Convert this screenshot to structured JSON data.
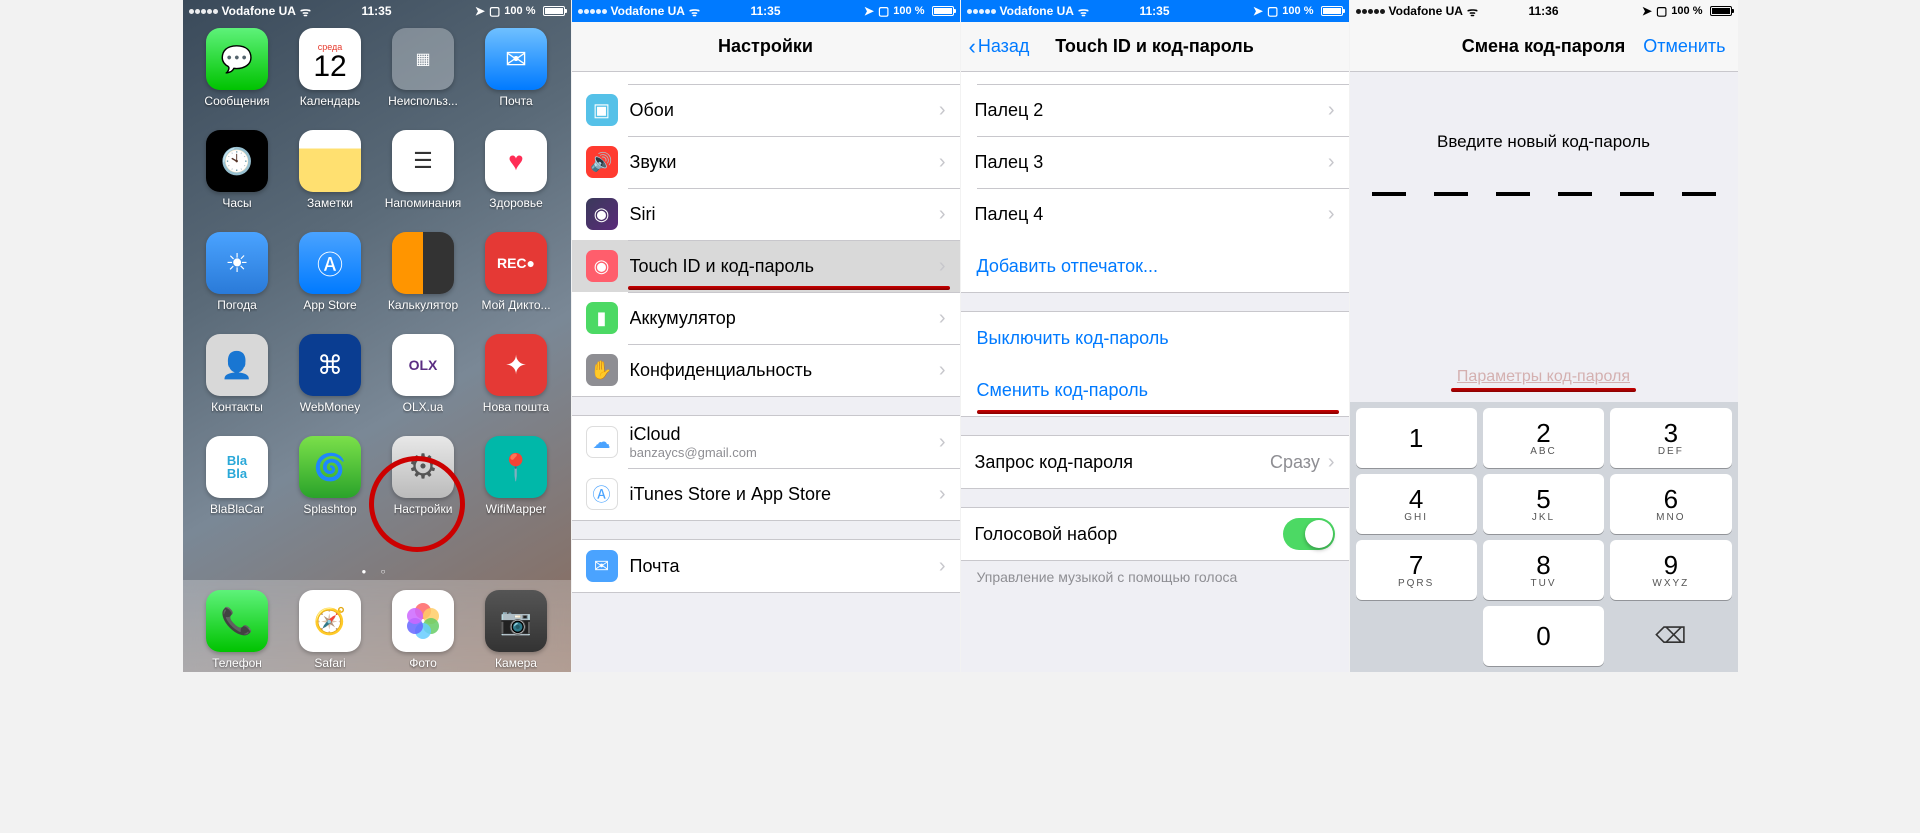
{
  "status": {
    "carrier": "Vodafone UA",
    "time1": "11:35",
    "time2": "11:36",
    "battery": "100 %"
  },
  "panel1": {
    "calendar_dow": "среда",
    "calendar_day": "12",
    "apps": {
      "messages": "Сообщения",
      "calendar": "Календарь",
      "folder": "Неиспольз...",
      "mail": "Почта",
      "clock": "Часы",
      "notes": "Заметки",
      "reminders": "Напоминания",
      "health": "Здоровье",
      "weather": "Погода",
      "appstore": "App Store",
      "calc": "Калькулятор",
      "rec": "Мой Дикто...",
      "contacts": "Контакты",
      "webmoney": "WebMoney",
      "olx": "OLX.ua",
      "nova": "Нова пошта",
      "blabla": "BlaBlaCar",
      "splashtop": "Splashtop",
      "settings": "Настройки",
      "wifimapper": "WifiMapper"
    },
    "dock": {
      "phone": "Телефон",
      "safari": "Safari",
      "photos": "Фото",
      "camera": "Камера"
    },
    "rec_text": "REC●"
  },
  "panel2": {
    "title": "Настройки",
    "rows": {
      "wallpaper": "Обои",
      "sounds": "Звуки",
      "siri": "Siri",
      "touchid": "Touch ID и код-пароль",
      "battery": "Аккумулятор",
      "privacy": "Конфиденциальность",
      "icloud": "iCloud",
      "icloud_sub": "banzaycs@gmail.com",
      "itunes": "iTunes Store и App Store",
      "mail": "Почта"
    }
  },
  "panel3": {
    "back": "Назад",
    "title": "Touch ID и код-пароль",
    "finger2": "Палец 2",
    "finger3": "Палец 3",
    "finger4": "Палец 4",
    "add": "Добавить отпечаток...",
    "turnoff": "Выключить код-пароль",
    "change": "Сменить код-пароль",
    "require": "Запрос код-пароля",
    "require_val": "Сразу",
    "voice": "Голосовой набор",
    "footer": "Управление музыкой с помощью голоса"
  },
  "panel4": {
    "title": "Смена код-пароля",
    "cancel": "Отменить",
    "prompt": "Введите новый код-пароль",
    "options": "Параметры код-пароля",
    "keys": [
      {
        "n": "1",
        "l": ""
      },
      {
        "n": "2",
        "l": "ABC"
      },
      {
        "n": "3",
        "l": "DEF"
      },
      {
        "n": "4",
        "l": "GHI"
      },
      {
        "n": "5",
        "l": "JKL"
      },
      {
        "n": "6",
        "l": "MNO"
      },
      {
        "n": "7",
        "l": "PQRS"
      },
      {
        "n": "8",
        "l": "TUV"
      },
      {
        "n": "9",
        "l": "WXYZ"
      },
      {
        "n": "",
        "l": ""
      },
      {
        "n": "0",
        "l": ""
      },
      {
        "n": "⌫",
        "l": ""
      }
    ]
  }
}
